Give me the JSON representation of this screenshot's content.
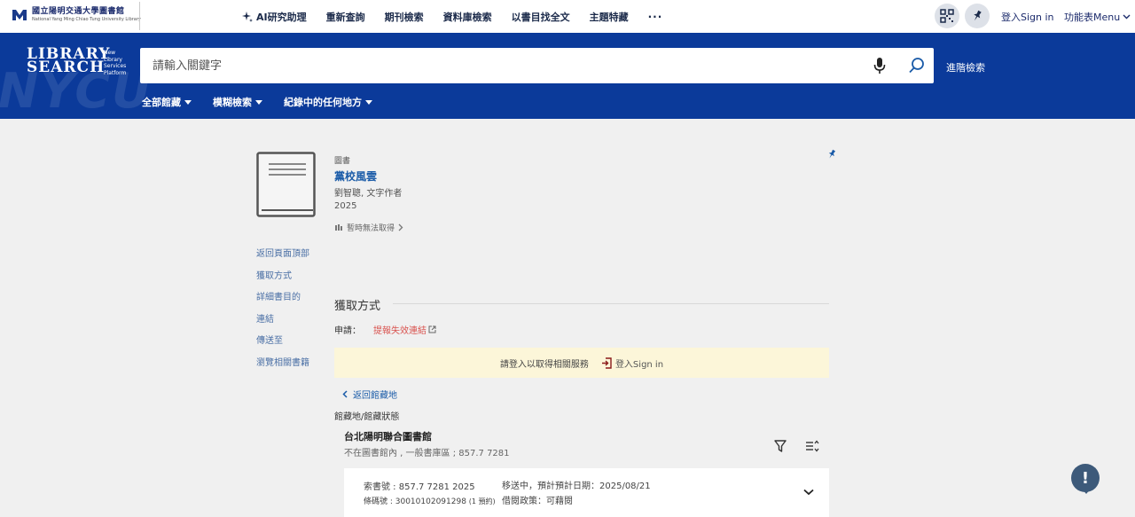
{
  "header": {
    "logo_zh": "國立陽明交通大學圖書館",
    "logo_en": "National Yang Ming Chiao Tung University Library",
    "nav": [
      {
        "label": "AI研究助理"
      },
      {
        "label": "重新查詢"
      },
      {
        "label": "期刊檢索"
      },
      {
        "label": "資料庫檢索"
      },
      {
        "label": "以書目找全文"
      },
      {
        "label": "主題特藏"
      }
    ],
    "more": "···",
    "signin": "登入Sign in",
    "menu": "功能表Menu"
  },
  "search": {
    "brand_line1": "LIBRARY",
    "brand_line2": "SEARCH",
    "brand_sub": [
      "New",
      "Library",
      "Services",
      "Platform"
    ],
    "watermark": "NYCU",
    "placeholder": "請輸入關鍵字",
    "advanced": "進階檢索",
    "filters": [
      "全部館藏",
      "模糊檢索",
      "紀錄中的任何地方"
    ]
  },
  "record": {
    "type": "圖書",
    "title": "黨校風雲",
    "author": "劉智聰, 文字作者",
    "year": "2025",
    "availability": "暫時無法取得"
  },
  "side_nav": [
    "返回頁面頂部",
    "獲取方式",
    "詳細書目的",
    "連結",
    "傳送至",
    "瀏覽相關書籍"
  ],
  "get_it": {
    "title": "獲取方式",
    "request_label": "申請：",
    "report_link": "提報失效連結",
    "notice": "請登入以取得相關服務",
    "notice_signin": "登入Sign in",
    "back": "返回館藏地",
    "location_heading": "館藏地/館藏狀態",
    "library_name": "台北陽明聯合圖書館",
    "library_status": "不在圖書館內 , 一般書庫區 ; 857.7 7281",
    "item": {
      "call_number": "索書號 : 857.7 7281 2025",
      "barcode": "條碼號 : 30010102091298",
      "holds": "(1 預約)",
      "transit": "移送中，預計預計日期：2025/08/21",
      "policy": "借閱政策：可藉閱"
    }
  },
  "colors": {
    "band": "#0b3a9a",
    "link": "#1a5ba8",
    "notice_bg": "#fcf6d9",
    "alert_link": "#d9534f"
  },
  "help": "!"
}
